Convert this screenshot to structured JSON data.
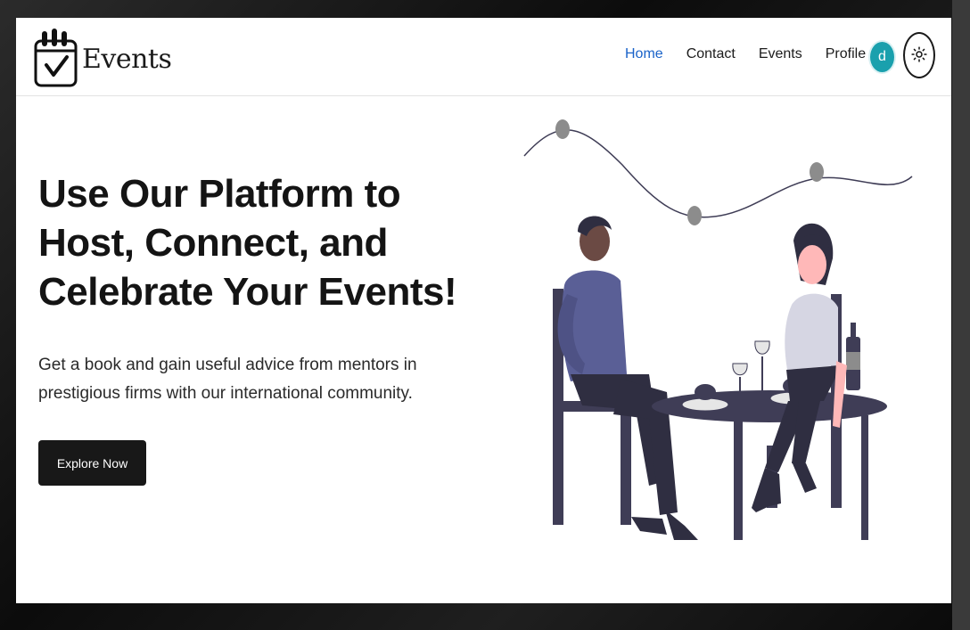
{
  "brand": {
    "name": "Events",
    "icon": "calendar-check-icon"
  },
  "nav": {
    "items": [
      {
        "label": "Home",
        "active": true
      },
      {
        "label": "Contact",
        "active": false
      },
      {
        "label": "Events",
        "active": false
      },
      {
        "label": "Profile",
        "active": false
      }
    ],
    "avatar_initial": "d",
    "theme_toggle_icon": "sun-icon"
  },
  "hero": {
    "title": "Use Our Platform to Host, Connect, and Celebrate Your Events!",
    "subtitle": "Get a book and gain useful advice from mentors in prestigious firms with our international community.",
    "cta_label": "Explore Now",
    "illustration": "couple-dinner-illustration"
  },
  "colors": {
    "active_link": "#1a63c9",
    "avatar_bg": "#1aa0ad",
    "button_bg": "#181818",
    "illustration_dark": "#3f3d56",
    "shirt_man": "#5a5f96"
  }
}
